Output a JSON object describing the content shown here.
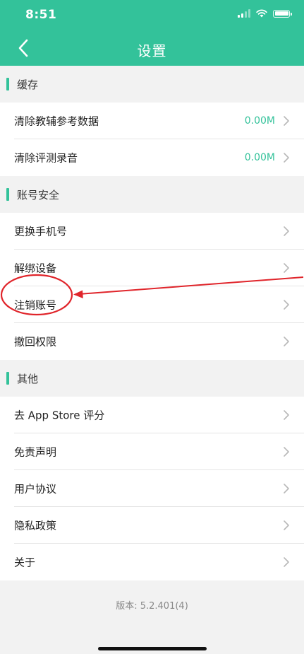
{
  "status_bar": {
    "time": "8:51"
  },
  "nav": {
    "title": "设置",
    "back_icon": "chevron-left-icon"
  },
  "sections": [
    {
      "title": "缓存",
      "items": [
        {
          "label": "清除教辅参考数据",
          "value": "0.00M"
        },
        {
          "label": "清除评测录音",
          "value": "0.00M"
        }
      ]
    },
    {
      "title": "账号安全",
      "items": [
        {
          "label": "更换手机号"
        },
        {
          "label": "解绑设备"
        },
        {
          "label": "注销账号"
        },
        {
          "label": "撤回权限"
        }
      ]
    },
    {
      "title": "其他",
      "items": [
        {
          "label": "去 App Store 评分"
        },
        {
          "label": "免责声明"
        },
        {
          "label": "用户协议"
        },
        {
          "label": "隐私政策"
        },
        {
          "label": "关于"
        }
      ]
    }
  ],
  "footer": {
    "version": "版本: 5.2.401(4)"
  },
  "colors": {
    "accent": "#33c29a",
    "annotation": "#e0252b"
  }
}
